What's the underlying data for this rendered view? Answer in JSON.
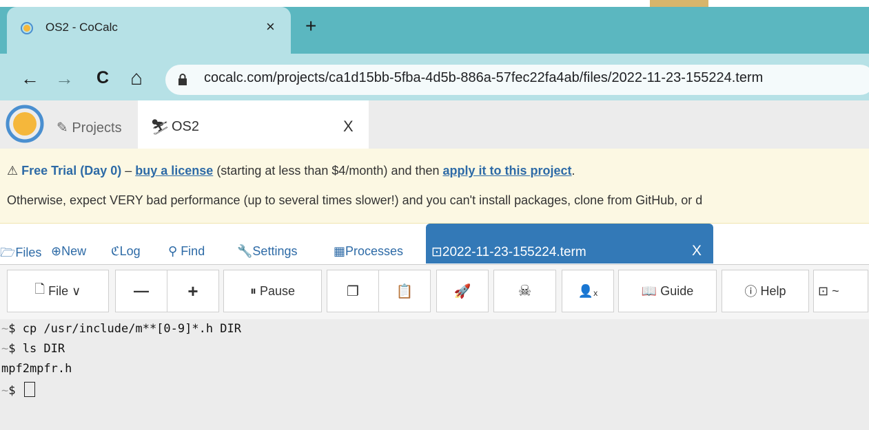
{
  "browser": {
    "tab_title": "OS2 - CoCalc",
    "tab_close": "×",
    "new_tab": "+",
    "back": "←",
    "forward": "→",
    "reload": "C",
    "home": "⌂",
    "url": "cocalc.com/projects/ca1d15bb-5fba-4d5b-886a-57fec22fa4ab/files/2022-11-23-155224.term"
  },
  "app": {
    "projects_label": "Projects",
    "project_name": "OS2",
    "project_close": "X"
  },
  "banner": {
    "warning_icon": "⚠",
    "trial": "Free Trial (Day 0)",
    "dash": " – ",
    "buy_link": "buy a license",
    "mid_text": " (starting at less than $4/month) and then ",
    "apply_link": "apply it to this project",
    "end_text": ".",
    "line2": "Otherwise, expect VERY bad performance (up to several times slower!) and you can't install packages, clone from GitHub, or d"
  },
  "project_nav": {
    "files": "Files",
    "new": "New",
    "log": "Log",
    "find": "Find",
    "settings": "Settings",
    "processes": "Processes",
    "open_file": "2022-11-23-155224.term",
    "open_file_close": "X"
  },
  "toolbar": {
    "file": "File ∨",
    "minus": "—",
    "plus": "+",
    "pause": "Pause",
    "guide": "Guide",
    "help": "Help",
    "shell": "~"
  },
  "terminal": {
    "lines": [
      {
        "prompt": "~",
        "text": "$ cp /usr/include/m**[0-9]*.h DIR"
      },
      {
        "prompt": "~",
        "text": "$ ls DIR"
      },
      {
        "prompt": "",
        "text": "mpf2mpfr.h"
      },
      {
        "prompt": "~",
        "text": "$ "
      }
    ]
  },
  "colors": {
    "browser_tabstrip": "#5bb7c0",
    "browser_toolbar": "#b6e1e6",
    "cocalc_blue": "#3379b7",
    "banner_bg": "#fcf8e3"
  }
}
